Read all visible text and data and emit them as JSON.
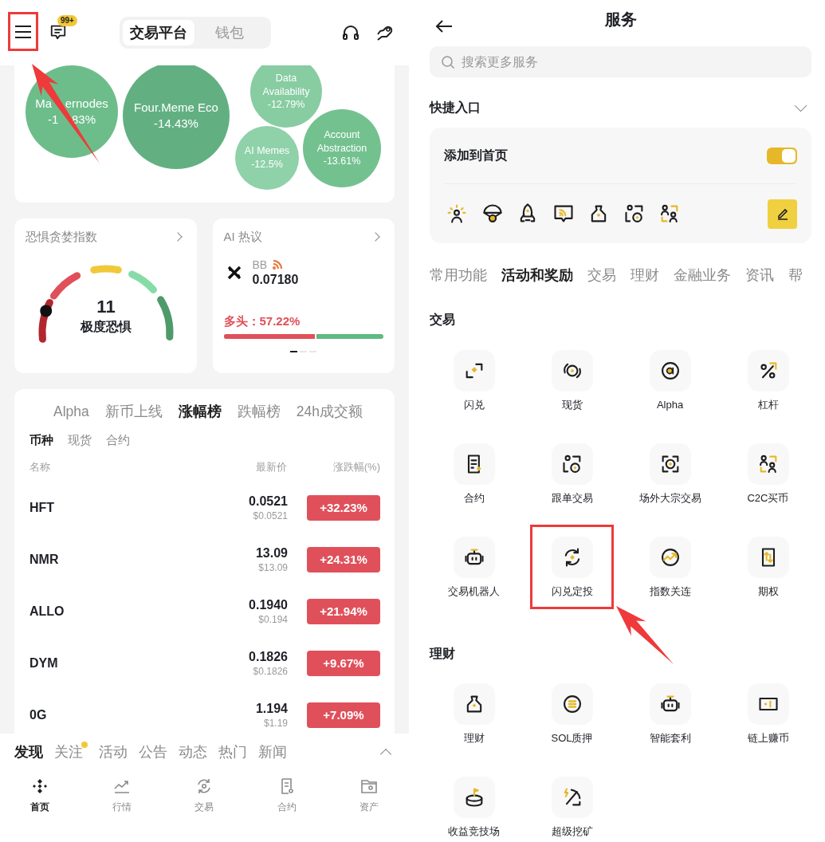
{
  "top_bar": {
    "menu": {
      "highlighted": true
    },
    "messages_badge": "99+",
    "segments": [
      {
        "label": "交易平台",
        "selected": true
      },
      {
        "label": "钱包",
        "selected": false
      }
    ]
  },
  "sectors": [
    {
      "label": "Ma    ernodes",
      "change": "-1    83%"
    },
    {
      "label": "Four.Meme Eco",
      "change": "-14.43%"
    },
    {
      "label": "Data Availability",
      "change": "-12.79%"
    },
    {
      "label": "AI Memes",
      "change": "-12.5%"
    },
    {
      "label": "Account Abstraction",
      "change": "-13.61%"
    }
  ],
  "fear_greed": {
    "title": "恐惧贪婪指数",
    "value": "11",
    "rating": "极度恐惧",
    "level": 0.11
  },
  "ai_hot": {
    "title": "AI 热议",
    "symbol": "BB",
    "price": "0.07180",
    "long_label": "多头：57.22%",
    "level": 0.5722,
    "pages": [
      {
        "selected": true
      },
      {
        "selected": false
      },
      {
        "selected": false
      }
    ]
  },
  "market": {
    "tabs": [
      {
        "label": "Alpha",
        "selected": false
      },
      {
        "label": "新币上线",
        "selected": false
      },
      {
        "label": "涨幅榜",
        "selected": true
      },
      {
        "label": "跌幅榜",
        "selected": false
      },
      {
        "label": "24h成交额",
        "selected": false
      }
    ],
    "sub_tabs": [
      {
        "label": "币种",
        "selected": true
      },
      {
        "label": "现货",
        "selected": false
      },
      {
        "label": "合约",
        "selected": false
      }
    ],
    "columns": [
      "名称",
      "最新价",
      "涨跌幅(%)"
    ],
    "rows": [
      {
        "name": "HFT",
        "price": "0.0521",
        "usd": "$0.0521",
        "change": "+32.23%"
      },
      {
        "name": "NMR",
        "price": "13.09",
        "usd": "$13.09",
        "change": "+24.31%"
      },
      {
        "name": "ALLO",
        "price": "0.1940",
        "usd": "$0.194",
        "change": "+21.94%"
      },
      {
        "name": "DYM",
        "price": "0.1826",
        "usd": "$0.1826",
        "change": "+9.67%"
      },
      {
        "name": "0G",
        "price": "1.194",
        "usd": "$1.19",
        "change": "+7.09%"
      }
    ]
  },
  "feed_tabs": [
    {
      "label": "发现",
      "selected": true,
      "dot": false
    },
    {
      "label": "关注",
      "selected": false,
      "dot": true
    },
    {
      "label": "活动",
      "selected": false,
      "dot": false
    },
    {
      "label": "公告",
      "selected": false,
      "dot": false
    },
    {
      "label": "动态",
      "selected": false,
      "dot": false
    },
    {
      "label": "热门",
      "selected": false,
      "dot": false
    },
    {
      "label": "新闻",
      "selected": false,
      "dot": false
    }
  ],
  "nav": [
    {
      "label": "首页",
      "selected": true
    },
    {
      "label": "行情",
      "selected": false
    },
    {
      "label": "交易",
      "selected": false
    },
    {
      "label": "合约",
      "selected": false
    },
    {
      "label": "资产",
      "selected": false
    }
  ],
  "services": {
    "title": "服务",
    "search_placeholder": "搜索更多服务",
    "shortcuts": {
      "title": "快捷入口",
      "add_label": "添加到首页",
      "on": true
    },
    "categories": [
      {
        "label": "常用功能",
        "selected": false
      },
      {
        "label": "活动和奖励",
        "selected": true
      },
      {
        "label": "交易",
        "selected": false
      },
      {
        "label": "理财",
        "selected": false
      },
      {
        "label": "金融业务",
        "selected": false
      },
      {
        "label": "资讯",
        "selected": false
      },
      {
        "label": "帮",
        "selected": false
      }
    ],
    "sections": [
      {
        "title": "交易",
        "items": [
          {
            "label": "闪兑",
            "highlighted": false
          },
          {
            "label": "现货",
            "highlighted": false
          },
          {
            "label": "Alpha",
            "highlighted": false
          },
          {
            "label": "杠杆",
            "highlighted": false
          },
          {
            "label": "合约",
            "highlighted": false
          },
          {
            "label": "跟单交易",
            "highlighted": false
          },
          {
            "label": "场外大宗交易",
            "highlighted": false
          },
          {
            "label": "C2C买币",
            "highlighted": false
          },
          {
            "label": "交易机器人",
            "highlighted": false
          },
          {
            "label": "闪兑定投",
            "highlighted": true
          },
          {
            "label": "指数关连",
            "highlighted": false
          },
          {
            "label": "期权",
            "highlighted": false
          }
        ]
      },
      {
        "title": "理财",
        "items": [
          {
            "label": "理财",
            "highlighted": false
          },
          {
            "label": "SOL质押",
            "highlighted": false
          },
          {
            "label": "智能套利",
            "highlighted": false
          },
          {
            "label": "链上赚币",
            "highlighted": false
          },
          {
            "label": "收益竞技场",
            "highlighted": false
          },
          {
            "label": "超级挖矿",
            "highlighted": false
          }
        ]
      }
    ]
  }
}
